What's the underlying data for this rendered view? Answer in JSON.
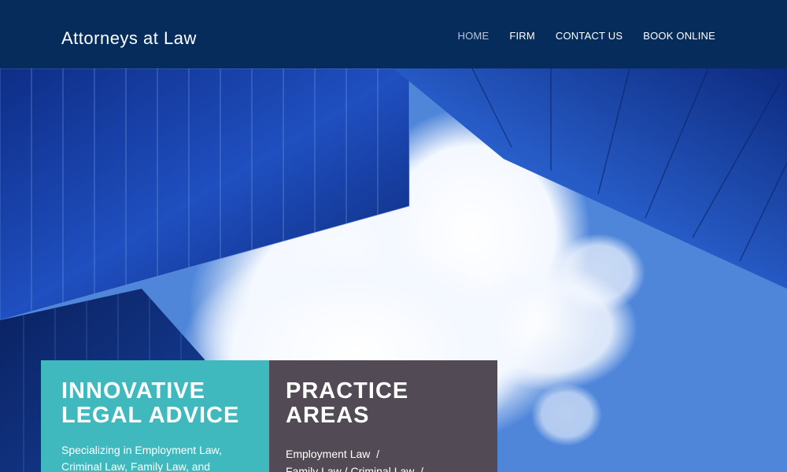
{
  "header": {
    "brand": "Attorneys at Law",
    "nav": [
      {
        "label": "HOME",
        "active": true
      },
      {
        "label": "FIRM",
        "active": false
      },
      {
        "label": "CONTACT US",
        "active": false
      },
      {
        "label": "BOOK ONLINE",
        "active": false
      }
    ]
  },
  "hero": {
    "image": "skyscrapers-against-blue-sky"
  },
  "cards": {
    "teal": {
      "title_line1": "INNOVATIVE",
      "title_line2": "LEGAL ADVICE",
      "text": "Specializing in Employment Law, Criminal Law, Family Law, and"
    },
    "dark": {
      "title_line1": "PRACTICE",
      "title_line2": "AREAS",
      "line1": "Employment Law  /",
      "line2": "Family Law / Criminal Law  /"
    }
  },
  "colors": {
    "header_bg": "#062c5c",
    "nav_active": "#b9c6d8",
    "teal": "#3fb9bd",
    "dark": "#524b56"
  }
}
